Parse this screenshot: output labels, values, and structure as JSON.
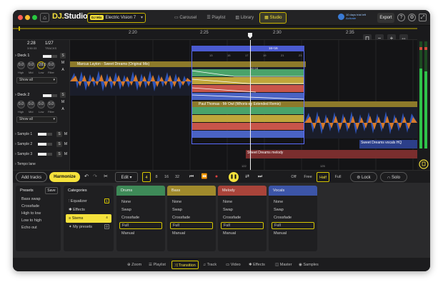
{
  "app": {
    "brand_prefix": "DJ.",
    "brand_name": "Studio",
    "mix_tag": "DJ Mix",
    "mix_name": "Electric Vision 7",
    "mode_tabs": [
      "Carousel",
      "Playlist",
      "Library",
      "Studio"
    ],
    "active_mode": "Studio",
    "trial_text": "10 days trial left",
    "trial_link": "Activate",
    "export_label": "Export"
  },
  "ruler": {
    "times": [
      "2:20",
      "2:25",
      "2:30",
      "2:35"
    ],
    "zoom_percent": "6%",
    "position": "2:28",
    "position_total": "3:50:33",
    "track_index": "1/27",
    "track_label": "TRACKS"
  },
  "decks": [
    {
      "name": "Deck 1",
      "eq": [
        {
          "v": "0.0",
          "l": "High"
        },
        {
          "v": "0.0",
          "l": "Mid"
        },
        {
          "v": "-28.0",
          "l": "Low"
        },
        {
          "v": "0.0",
          "l": "Filter"
        }
      ],
      "show": "Show all"
    },
    {
      "name": "Deck 2",
      "eq": [
        {
          "v": "0.0",
          "l": "High"
        },
        {
          "v": "0.0",
          "l": "Mid"
        },
        {
          "v": "0.0",
          "l": "Low"
        },
        {
          "v": "0.0",
          "l": "Filter"
        }
      ],
      "show": "Show all"
    }
  ],
  "samples": [
    "Sample 1",
    "Sample 2",
    "Sample 3"
  ],
  "tempo_lane": "Tempo lane",
  "clips": {
    "deck1": "Marcus Layton - Sweet Dreams (Original Mix)",
    "deck2": "Paul Thomas - Mr Owl (Whoris-ey Extended Remix)",
    "sample1": "Sweet Dreams vocals HQ",
    "sample3": "Sweet Dreams melody",
    "transition_badge": "16+16"
  },
  "beats": [
    "13",
    "15",
    "17",
    "19",
    "21",
    "23"
  ],
  "bottom_beats": [
    "122",
    "125"
  ],
  "transport": {
    "add_tracks": "Add tracks",
    "harmonize": "Harmonize",
    "edit": "Edit",
    "loop_sizes": [
      "4",
      "8",
      "16",
      "32"
    ],
    "active_loop": "4",
    "modes": [
      "Off",
      "Free",
      "Half",
      "Full"
    ],
    "active_mode": "Half",
    "lock": "Lock",
    "solo": "Solo"
  },
  "presets": {
    "title": "Presets",
    "save": "Save",
    "items": [
      "Bass swap",
      "Crossfade",
      "High to low",
      "Low to high",
      "Echo out"
    ]
  },
  "categories": {
    "title": "Categories",
    "items": [
      {
        "label": "Equalizer",
        "count": "1"
      },
      {
        "label": "Effects",
        "count": ""
      },
      {
        "label": "Stems",
        "count": "4"
      },
      {
        "label": "My presets",
        "count": "0"
      }
    ],
    "selected": "Stems"
  },
  "stems": [
    {
      "title": "Drums",
      "color": "#3e8a58",
      "options": [
        "None",
        "Swap",
        "Crossfade",
        "Full",
        "Manual"
      ],
      "selected": "Full"
    },
    {
      "title": "Bass",
      "color": "#a08a2c",
      "options": [
        "None",
        "Swap",
        "Crossfade",
        "Full",
        "Manual"
      ],
      "selected": "Full"
    },
    {
      "title": "Melody",
      "color": "#a9443a",
      "options": [
        "None",
        "Swap",
        "Crossfade",
        "Full",
        "Manual"
      ],
      "selected": "Full"
    },
    {
      "title": "Vocals",
      "color": "#3c55a8",
      "options": [
        "None",
        "Swap",
        "Crossfade",
        "Full",
        "Manual"
      ],
      "selected": "Full"
    }
  ],
  "footer_tabs": [
    "Zoom",
    "Playlist",
    "Transition",
    "Track",
    "Video",
    "Effects",
    "Master",
    "Samples"
  ],
  "footer_active": "Transition"
}
